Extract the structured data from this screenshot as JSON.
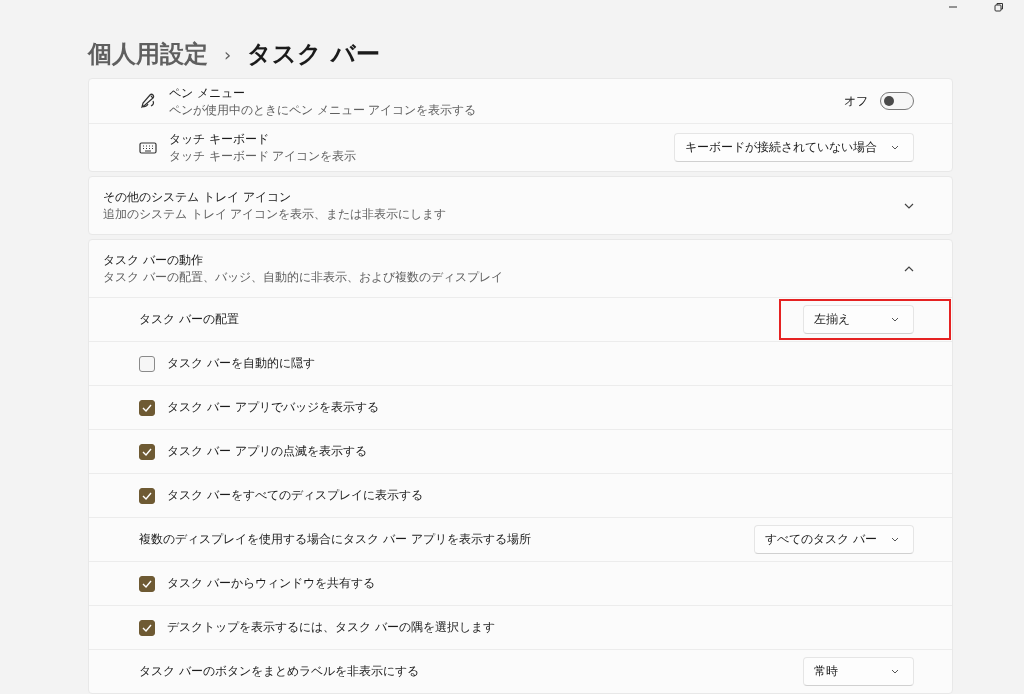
{
  "breadcrumb": {
    "parent": "個人用設定",
    "separator": "›",
    "current": "タスク バー"
  },
  "top_rows": [
    {
      "kind": "toggle",
      "title": "ペン メニュー",
      "subtitle": "ペンが使用中のときにペン メニュー アイコンを表示する",
      "state_label": "オフ",
      "on": false
    },
    {
      "kind": "dropdown",
      "title": "タッチ キーボード",
      "subtitle": "タッチ キーボード アイコンを表示",
      "value": "キーボードが接続されていない場合"
    }
  ],
  "sections": [
    {
      "title": "その他のシステム トレイ アイコン",
      "subtitle": "追加のシステム トレイ アイコンを表示、または非表示にします",
      "expanded": false
    },
    {
      "title": "タスク バーの動作",
      "subtitle": "タスク バーの配置、バッジ、自動的に非表示、および複数のディスプレイ",
      "expanded": true,
      "rows": [
        {
          "kind": "dropdown",
          "label": "タスク バーの配置",
          "value": "左揃え",
          "highlighted": true
        },
        {
          "kind": "checkbox",
          "label": "タスク バーを自動的に隠す",
          "checked": false
        },
        {
          "kind": "checkbox",
          "label": "タスク バー アプリでバッジを表示する",
          "checked": true
        },
        {
          "kind": "checkbox",
          "label": "タスク バー アプリの点滅を表示する",
          "checked": true
        },
        {
          "kind": "checkbox",
          "label": "タスク バーをすべてのディスプレイに表示する",
          "checked": true
        },
        {
          "kind": "dropdown",
          "label": "複数のディスプレイを使用する場合にタスク バー アプリを表示する場所",
          "value": "すべてのタスク バー",
          "highlighted": false
        },
        {
          "kind": "checkbox",
          "label": "タスク バーからウィンドウを共有する",
          "checked": true
        },
        {
          "kind": "checkbox",
          "label": "デスクトップを表示するには、タスク バーの隅を選択します",
          "checked": true
        },
        {
          "kind": "dropdown",
          "label": "タスク バーのボタンをまとめラベルを非表示にする",
          "value": "常時",
          "highlighted": false
        }
      ]
    }
  ]
}
